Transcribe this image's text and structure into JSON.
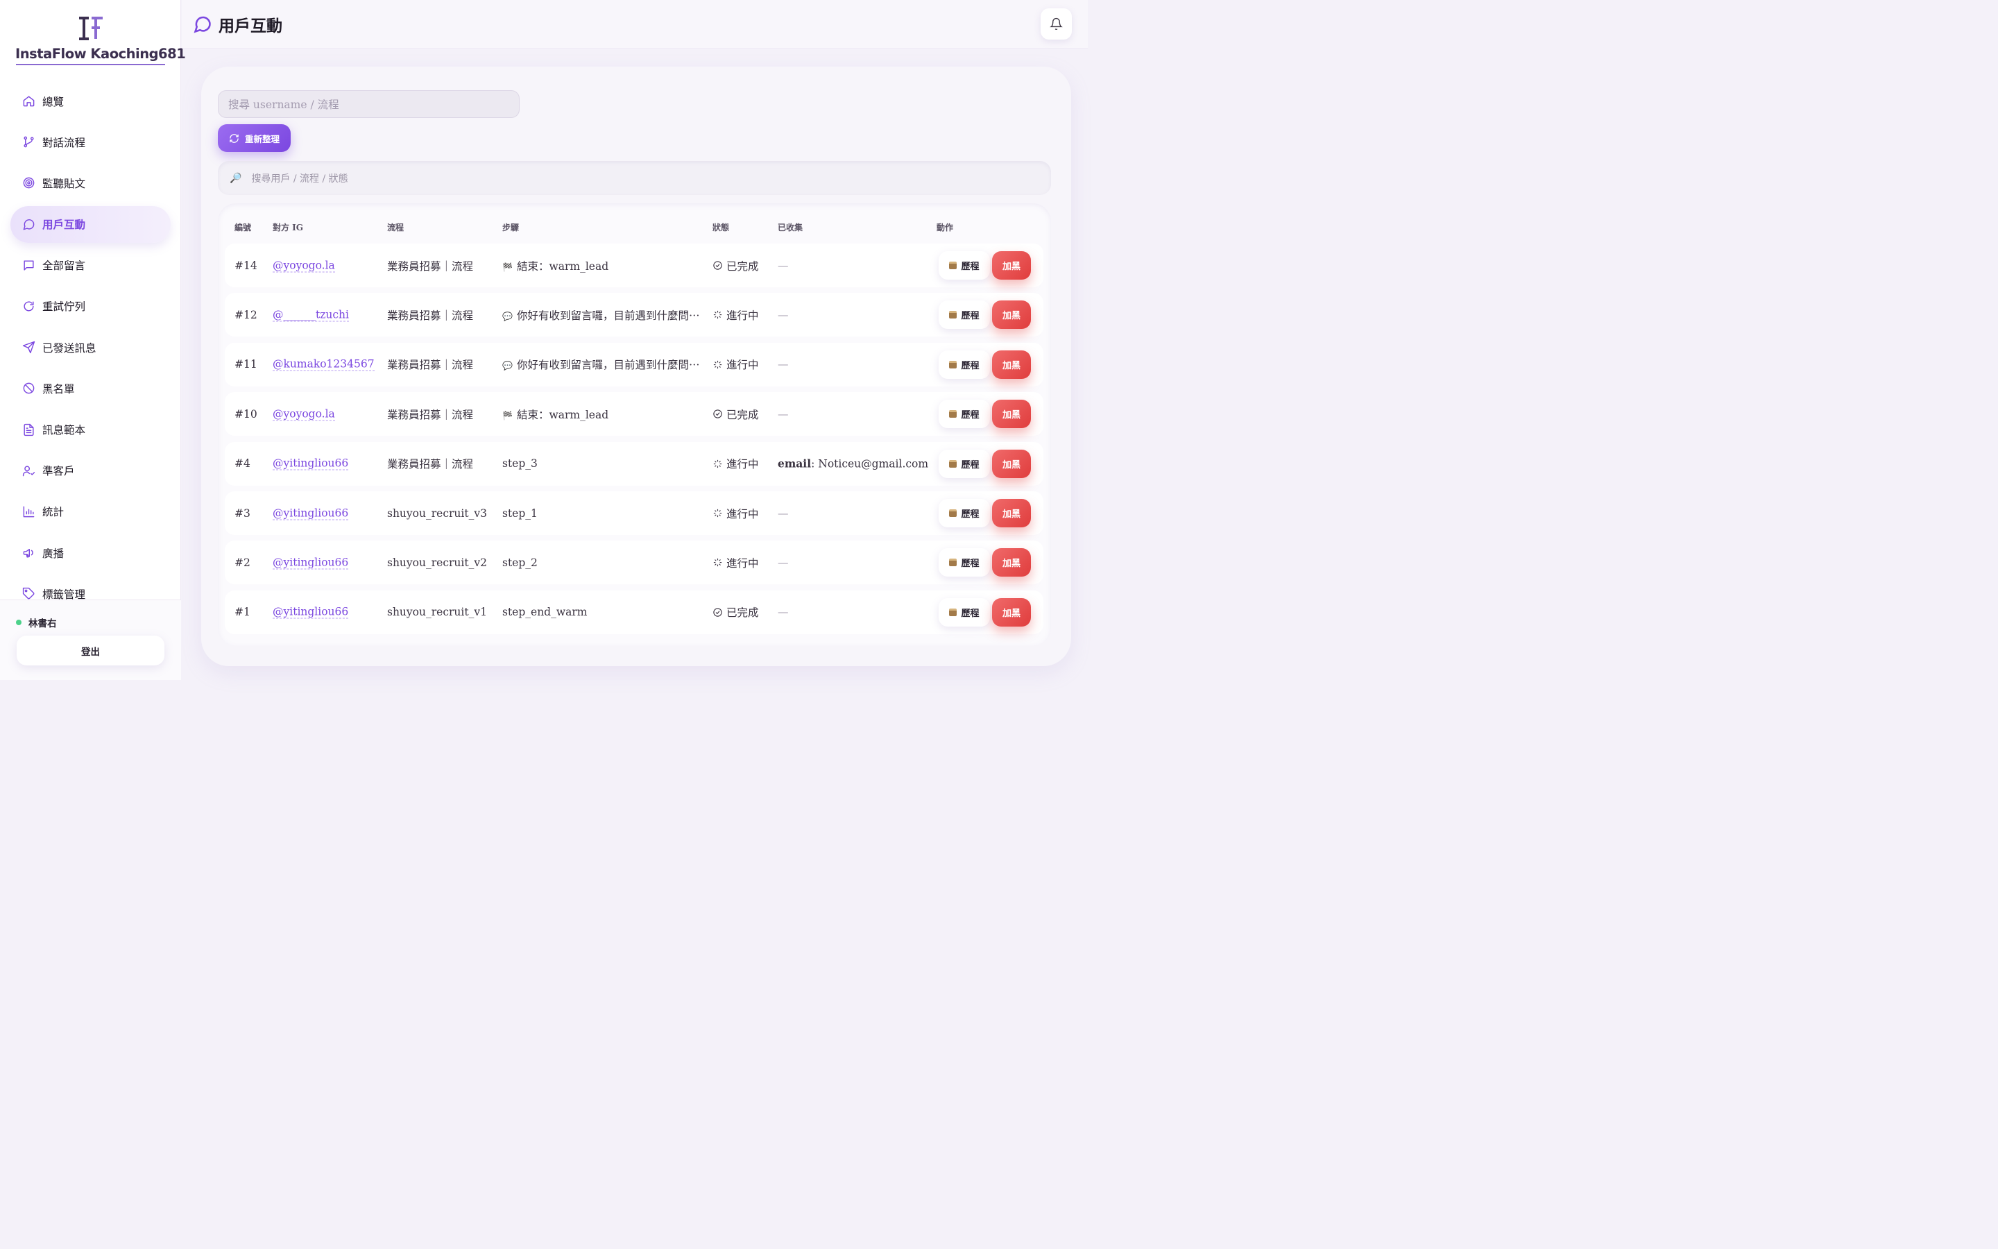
{
  "brand": {
    "name": "InstaFlow Kaoching681",
    "mark": "IF",
    "accent": "#7b47e0"
  },
  "sidebar": {
    "items": [
      {
        "label": "總覽",
        "icon": "home-icon"
      },
      {
        "label": "對話流程",
        "icon": "git-branch-icon"
      },
      {
        "label": "監聽貼文",
        "icon": "target-icon"
      },
      {
        "label": "用戶互動",
        "icon": "chat-bubble-icon",
        "active": true
      },
      {
        "label": "全部留言",
        "icon": "message-square-icon"
      },
      {
        "label": "重試佇列",
        "icon": "refresh-icon"
      },
      {
        "label": "已發送訊息",
        "icon": "send-icon"
      },
      {
        "label": "黑名單",
        "icon": "ban-icon"
      },
      {
        "label": "訊息範本",
        "icon": "file-text-icon"
      },
      {
        "label": "準客戶",
        "icon": "user-check-icon"
      },
      {
        "label": "統計",
        "icon": "bar-chart-icon"
      },
      {
        "label": "廣播",
        "icon": "megaphone-icon"
      },
      {
        "label": "標籤管理",
        "icon": "tag-icon"
      }
    ]
  },
  "footer": {
    "user": "林書右",
    "logout": "登出"
  },
  "header": {
    "title": "用戶互動"
  },
  "filters": {
    "search_placeholder": "搜尋 username / 流程",
    "refresh_label": "重新整理",
    "table_search_placeholder": "搜尋用戶 / 流程 / 狀態"
  },
  "table": {
    "columns": [
      "編號",
      "對方 IG",
      "流程",
      "步驟",
      "狀態",
      "已收集",
      "動作"
    ],
    "history_label": "歷程",
    "block_label": "加黑",
    "rows": [
      {
        "id": "#14",
        "ig": "@yoyogo.la",
        "flow": "業務員招募｜流程",
        "step_icon": "🏁",
        "step": "結束：warm_lead",
        "status": "已完成",
        "done": true,
        "collected": "—"
      },
      {
        "id": "#12",
        "ig": "@______tzuchi",
        "flow": "業務員招募｜流程",
        "step_icon": "💬",
        "step": "你好有收到留言囉，目前遇到什麼問⋯",
        "status": "進行中",
        "done": false,
        "collected": "—"
      },
      {
        "id": "#11",
        "ig": "@kumako1234567",
        "flow": "業務員招募｜流程",
        "step_icon": "💬",
        "step": "你好有收到留言囉，目前遇到什麼問⋯",
        "status": "進行中",
        "done": false,
        "collected": "—"
      },
      {
        "id": "#10",
        "ig": "@yoyogo.la",
        "flow": "業務員招募｜流程",
        "step_icon": "🏁",
        "step": "結束：warm_lead",
        "status": "已完成",
        "done": true,
        "collected": "—"
      },
      {
        "id": "#4",
        "ig": "@yitingliou66",
        "flow": "業務員招募｜流程",
        "step_icon": "",
        "step": "step_3",
        "status": "進行中",
        "done": false,
        "collected_key": "email",
        "collected": "Noticeu@gmail.com"
      },
      {
        "id": "#3",
        "ig": "@yitingliou66",
        "flow": "shuyou_recruit_v3",
        "step_icon": "",
        "step": "step_1",
        "status": "進行中",
        "done": false,
        "collected": "—"
      },
      {
        "id": "#2",
        "ig": "@yitingliou66",
        "flow": "shuyou_recruit_v2",
        "step_icon": "",
        "step": "step_2",
        "status": "進行中",
        "done": false,
        "collected": "—"
      },
      {
        "id": "#1",
        "ig": "@yitingliou66",
        "flow": "shuyou_recruit_v1",
        "step_icon": "",
        "step": "step_end_warm",
        "status": "已完成",
        "done": true,
        "collected": "—"
      }
    ]
  }
}
